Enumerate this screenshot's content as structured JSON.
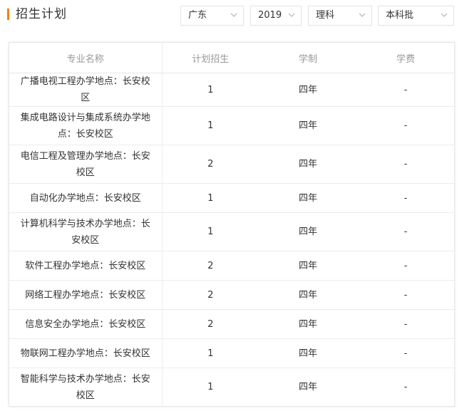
{
  "header": {
    "title": "招生计划",
    "filters": {
      "province": "广东",
      "year": "2019",
      "subject": "理科",
      "batch": "本科批"
    }
  },
  "table": {
    "columns": [
      "专业名称",
      "计划招生",
      "学制",
      "学费"
    ],
    "rows": [
      {
        "major": "广播电视工程办学地点：长安校区",
        "plan": "1",
        "duration": "四年",
        "tuition": "-"
      },
      {
        "major": "集成电路设计与集成系统办学地点：长安校区",
        "plan": "1",
        "duration": "四年",
        "tuition": "-"
      },
      {
        "major": "电信工程及管理办学地点：长安校区",
        "plan": "2",
        "duration": "四年",
        "tuition": "-"
      },
      {
        "major": "自动化办学地点：长安校区",
        "plan": "1",
        "duration": "四年",
        "tuition": "-"
      },
      {
        "major": "计算机科学与技术办学地点：长安校区",
        "plan": "1",
        "duration": "四年",
        "tuition": "-"
      },
      {
        "major": "软件工程办学地点：长安校区",
        "plan": "2",
        "duration": "四年",
        "tuition": "-"
      },
      {
        "major": "网络工程办学地点：长安校区",
        "plan": "2",
        "duration": "四年",
        "tuition": "-"
      },
      {
        "major": "信息安全办学地点：长安校区",
        "plan": "2",
        "duration": "四年",
        "tuition": "-"
      },
      {
        "major": "物联网工程办学地点：长安校区",
        "plan": "1",
        "duration": "四年",
        "tuition": "-"
      },
      {
        "major": "智能科学与技术办学地点：长安校区",
        "plan": "1",
        "duration": "四年",
        "tuition": "-"
      }
    ]
  },
  "colors": {
    "accent": "#f08300",
    "header_text": "#999999",
    "border": "#e6e6e6"
  },
  "icons": {
    "dropdown": "chevron-down-icon"
  }
}
